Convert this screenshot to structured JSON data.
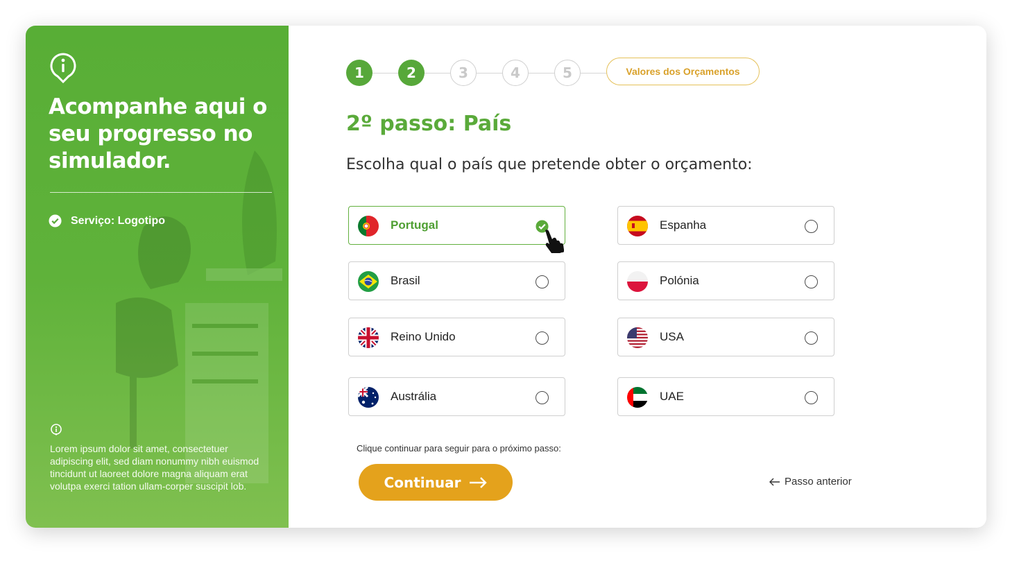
{
  "sidebar": {
    "heading": "Acompanhe aqui o seu progresso no simulador.",
    "service_label": "Serviço: Logotipo",
    "info_text": "Lorem ipsum dolor sit amet, consectetuer adipiscing elit, sed diam nonummy nibh euismod tincidunt ut laoreet dolore magna aliquam erat volutpa exerci tation ullam-corper suscipit lob."
  },
  "stepper": {
    "steps": [
      {
        "label": "1",
        "state": "done"
      },
      {
        "label": "2",
        "state": "done"
      },
      {
        "label": "3",
        "state": "todo"
      },
      {
        "label": "4",
        "state": "todo"
      },
      {
        "label": "5",
        "state": "todo"
      }
    ],
    "final_label": "Valores dos Orçamentos"
  },
  "main": {
    "title": "2º passo: País",
    "question": "Escolha qual o país que pretende obter o orçamento:",
    "countries": [
      {
        "label": "Portugal",
        "flag": "portugal-flag",
        "selected": true
      },
      {
        "label": "Espanha",
        "flag": "spain-flag",
        "selected": false
      },
      {
        "label": "Brasil",
        "flag": "brazil-flag",
        "selected": false
      },
      {
        "label": "Polónia",
        "flag": "poland-flag",
        "selected": false
      },
      {
        "label": "Reino Unido",
        "flag": "uk-flag",
        "selected": false
      },
      {
        "label": "USA",
        "flag": "usa-flag",
        "selected": false
      },
      {
        "label": "Austrália",
        "flag": "australia-flag",
        "selected": false
      },
      {
        "label": "UAE",
        "flag": "uae-flag",
        "selected": false
      }
    ],
    "hint": "Clique continuar para seguir para o próximo passo:",
    "continue_label": "Continuar",
    "back_label": "Passo anterior"
  },
  "colors": {
    "brand_green": "#5aaa3a",
    "accent_gold": "#e4a21c"
  }
}
